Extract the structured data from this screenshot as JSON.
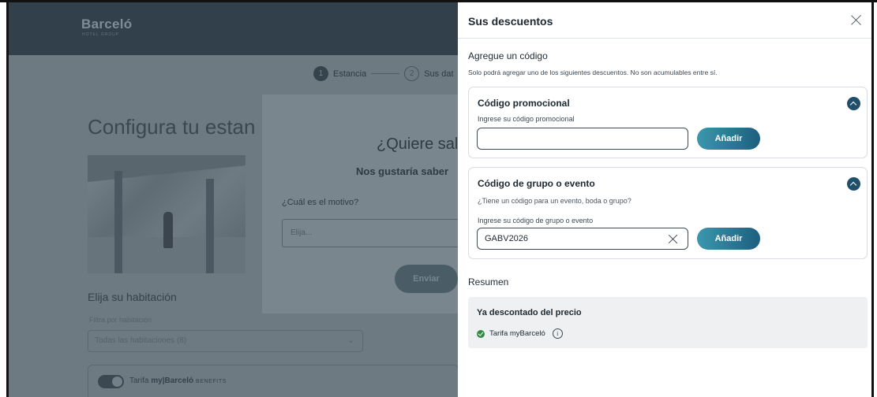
{
  "background": {
    "logo": "Barceló",
    "logo_sub": "HOTEL GROUP",
    "steps": [
      {
        "num": "1",
        "label": "Estancia"
      },
      {
        "num": "2",
        "label": "Sus dat"
      }
    ],
    "page_title": "Configura tu estan",
    "room_title": "Elija su habitación",
    "filter_label": "Filtra por habitación",
    "filter_value": "Todas las habitaciones (8)",
    "tarifa": {
      "prefix": "Tarifa",
      "brand": "my|Barceló",
      "benefits": "BENEFITS"
    }
  },
  "survey_modal": {
    "title": "¿Quiere sal",
    "subtitle": "Nos gustaría saber",
    "question": "¿Cuál es el motivo?",
    "select_placeholder": "Elija...",
    "submit_label": "Enviar"
  },
  "panel": {
    "title": "Sus descuentos",
    "add_title": "Agregue un código",
    "add_note": "Solo podrá agregar uno de los siguientes descuentos. No son acumulables entre sí.",
    "promo": {
      "title": "Código promocional",
      "input_label": "Ingrese su código promocional",
      "value": "",
      "button": "Añadir"
    },
    "group": {
      "title": "Código de grupo o evento",
      "subtitle": "¿Tiene un código para un evento, boda o grupo?",
      "input_label": "Ingrese su código de grupo o evento",
      "value": "GABV2026",
      "button": "Añadir"
    },
    "summary": {
      "title": "Resumen",
      "box_title": "Ya descontado del precio",
      "rate": "Tarifa myBarceló",
      "info_glyph": "i"
    }
  },
  "colors": {
    "accent_dark": "#1f4f6b",
    "button_gradient_start": "#3b97ad",
    "button_gradient_end": "#1d5f80",
    "success": "#2f8a43",
    "overlay": "#6d7a82"
  },
  "icons": [
    "close-icon",
    "chevron-up-icon",
    "clear-icon",
    "check-circle-icon",
    "info-icon",
    "chevron-down-icon"
  ]
}
